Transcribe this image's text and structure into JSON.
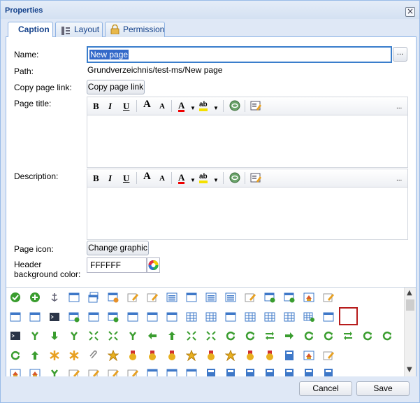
{
  "window": {
    "title": "Properties",
    "close_icon": "close-icon"
  },
  "tabs": [
    {
      "label": "Caption",
      "icon": "",
      "active": true
    },
    {
      "label": "Layout",
      "icon": "layout-icon",
      "active": false
    },
    {
      "label": "Permission",
      "icon": "lock-icon",
      "active": false
    }
  ],
  "form": {
    "name_label": "Name:",
    "name_value": "New page",
    "browse_label": "...",
    "path_label": "Path:",
    "path_value": "Grundverzeichnis/test-ms/New page",
    "copy_link_label": "Copy page link:",
    "copy_link_button": "Copy page link",
    "page_title_label": "Page title:",
    "description_label": "Description:",
    "page_icon_label": "Page icon:",
    "change_graphic_button": "Change graphic",
    "header_bg_label_1": "Header",
    "header_bg_label_2": "background color:",
    "header_bg_value": "FFFFFF"
  },
  "editor_toolbar": {
    "bold": "B",
    "italic": "I",
    "underline": "U",
    "grow_font": "A",
    "shrink_font": "A",
    "font_color": "A",
    "highlight": "ab",
    "more": "..."
  },
  "colors": {
    "accent": "#3a7ecc",
    "selection": "#3369c9",
    "title_text": "#15428b",
    "selected_icon_border": "#b71c1c",
    "icon_green": "#3a9d2f",
    "icon_blue": "#3e78c8"
  },
  "icon_grid": {
    "selected_icon": "table-icon"
  },
  "footer": {
    "cancel_label": "Cancel",
    "save_label": "Save"
  }
}
